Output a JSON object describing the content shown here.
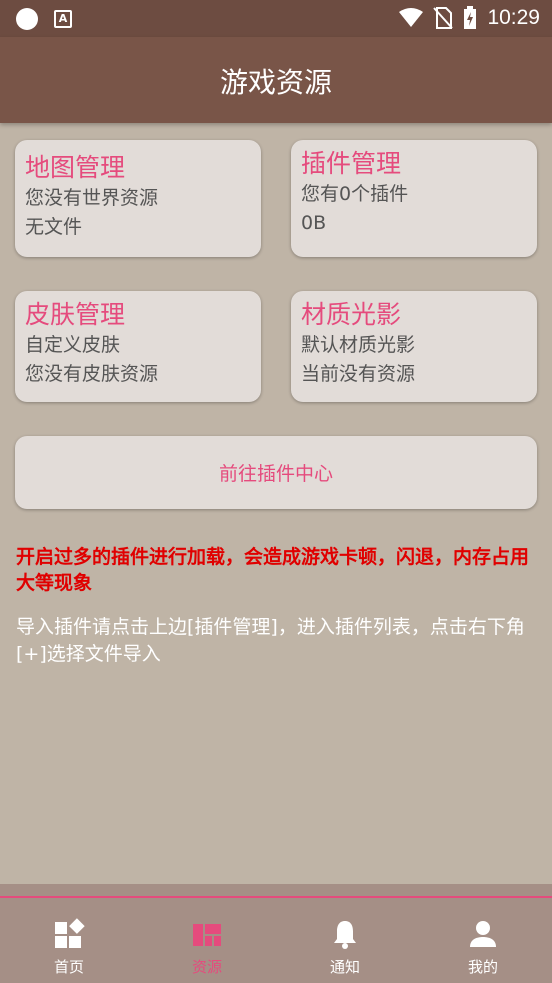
{
  "status_bar": {
    "time": "10:29",
    "icons": [
      "circle-icon",
      "a-icon",
      "wifi-icon",
      "no-sim-icon",
      "battery-charging-icon"
    ]
  },
  "app_bar": {
    "title": "游戏资源"
  },
  "cards": [
    {
      "title": "地图管理",
      "line1": "您没有世界资源",
      "line2": "无文件"
    },
    {
      "title": "插件管理",
      "line1": "您有0个插件",
      "line2": "0B"
    },
    {
      "title": "皮肤管理",
      "line1": "自定义皮肤",
      "line2": "您没有皮肤资源"
    },
    {
      "title": "材质光影",
      "line1": "默认材质光影",
      "line2": "当前没有资源"
    }
  ],
  "plugin_center_button": "前往插件中心",
  "warning_text": "开启过多的插件进行加载，会造成游戏卡顿，闪退，内存占用大等现象",
  "hint_text": "导入插件请点击上边[插件管理]，进入插件列表，点击右下角[+]选择文件导入",
  "bottom_nav": [
    {
      "label": "首页",
      "icon": "home-grid-icon",
      "active": false
    },
    {
      "label": "资源",
      "icon": "resources-icon",
      "active": true
    },
    {
      "label": "通知",
      "icon": "bell-icon",
      "active": false
    },
    {
      "label": "我的",
      "icon": "person-icon",
      "active": false
    }
  ],
  "colors": {
    "status_bar": "#6d4c41",
    "app_bar": "#795548",
    "background": "#bfb4a6",
    "card": "#e2dcd8",
    "accent": "#e54b7d",
    "warning": "#e00000",
    "bottom_nav": "#a58f86"
  }
}
